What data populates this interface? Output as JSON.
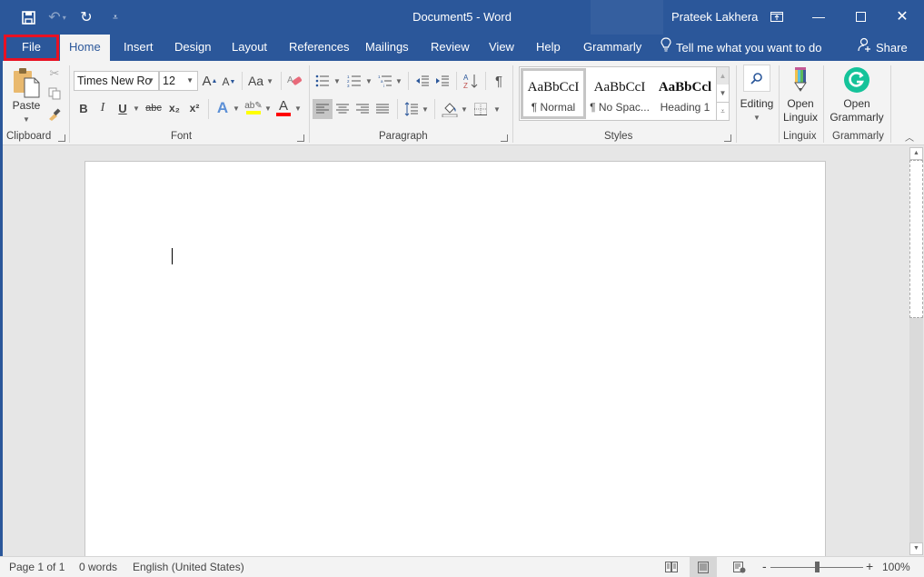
{
  "titlebar": {
    "doc_title": "Document5  -  Word",
    "user_name": "Prateek Lakhera",
    "qat": [
      "save-icon",
      "undo-icon",
      "redo-icon",
      "customize-qat-icon"
    ],
    "controls": [
      "ribbon-display-options",
      "minimize",
      "maximize",
      "close"
    ]
  },
  "tabs": {
    "file": "File",
    "items": [
      "Home",
      "Insert",
      "Design",
      "Layout",
      "References",
      "Mailings",
      "Review",
      "View",
      "Help",
      "Grammarly"
    ],
    "active": "Home",
    "tell_me": "Tell me what you want to do",
    "share": "Share"
  },
  "ribbon": {
    "clipboard": {
      "label": "Clipboard",
      "paste": "Paste"
    },
    "font": {
      "label": "Font",
      "font_name": "Times New Ro",
      "font_size": "12",
      "bold": "B",
      "italic": "I",
      "underline": "U",
      "strikethrough": "abc",
      "subscript": "x₂",
      "superscript": "x²",
      "change_case": "Aa",
      "highlight_color": "#ffff00",
      "font_color": "#ff0000"
    },
    "paragraph": {
      "label": "Paragraph",
      "pilcrow": "¶"
    },
    "styles": {
      "label": "Styles",
      "items": [
        {
          "sample": "AaBbCcI",
          "name": "¶ Normal",
          "selected": true
        },
        {
          "sample": "AaBbCcI",
          "name": "¶ No Spac...",
          "selected": false
        },
        {
          "sample": "AaBbCcl",
          "name": "Heading 1",
          "selected": false
        }
      ]
    },
    "editing": {
      "label": "Editing"
    },
    "linguix": {
      "button": "Open Linguix",
      "line1": "Open",
      "line2": "Linguix",
      "label": "Linguix"
    },
    "grammarly": {
      "button": "Open Grammarly",
      "line1": "Open",
      "line2": "Grammarly",
      "label": "Grammarly",
      "color": "#15c39a"
    }
  },
  "status": {
    "page": "Page 1 of 1",
    "words": "0 words",
    "language": "English (United States)",
    "zoom_minus": "-",
    "zoom_plus": "+",
    "zoom_level": "100%",
    "zoom_fraction": 0.5
  },
  "colors": {
    "brand": "#2b579a",
    "file_highlight": "#e81123"
  }
}
